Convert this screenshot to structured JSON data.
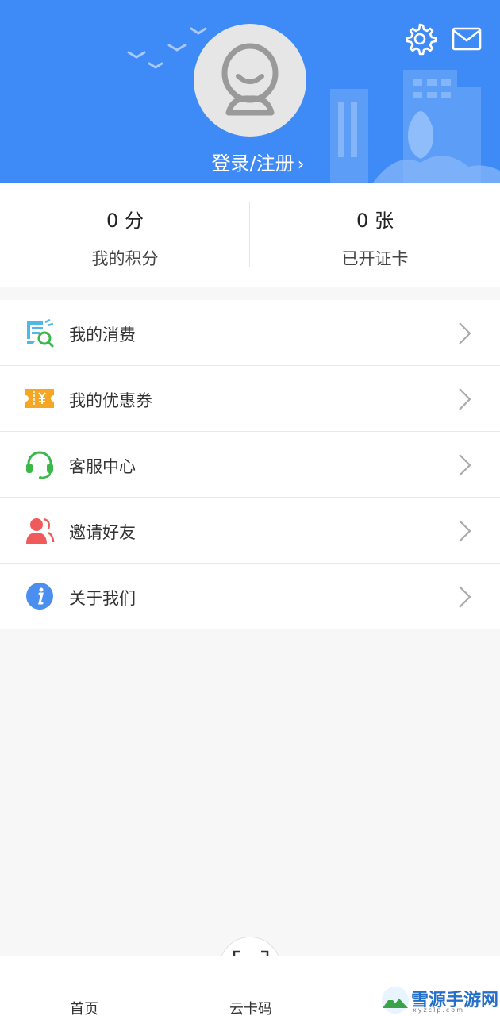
{
  "header": {
    "login_label": "登录/注册",
    "login_chevron": "›",
    "icons": {
      "settings": "gear-icon",
      "messages": "mail-icon",
      "avatar": "default-avatar-icon"
    }
  },
  "stats": [
    {
      "value": "0",
      "unit": "分",
      "label": "我的积分"
    },
    {
      "value": "0",
      "unit": "张",
      "label": "已开证卡"
    }
  ],
  "menu": [
    {
      "label": "我的消费",
      "icon": "consumption-icon",
      "color": "#4fb8e8"
    },
    {
      "label": "我的优惠券",
      "icon": "coupon-icon",
      "color": "#f5a623"
    },
    {
      "label": "客服中心",
      "icon": "headset-icon",
      "color": "#3cb84a"
    },
    {
      "label": "邀请好友",
      "icon": "invite-friends-icon",
      "color": "#f05a5a"
    },
    {
      "label": "关于我们",
      "icon": "info-icon",
      "color": "#4a8ef0"
    }
  ],
  "tabbar": {
    "home": "首页",
    "card": "云卡码",
    "scan_icon": "barcode-scan-icon"
  },
  "watermark": {
    "text": "雪源手游网",
    "sub": "xyzclp.com"
  },
  "colors": {
    "header_bg": "#3e8af7",
    "page_bg": "#f7f7f7"
  }
}
